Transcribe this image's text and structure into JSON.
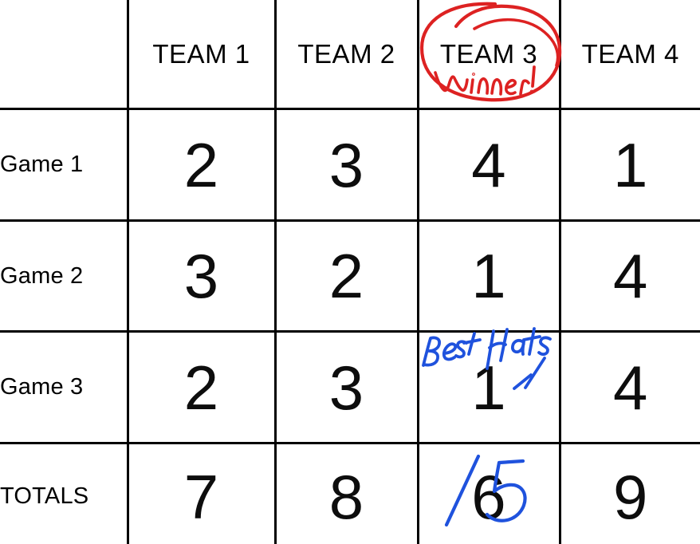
{
  "document": {
    "kind": "scoreboard-table-with-handwritten-annotations",
    "background_color": "#ffffff",
    "grid_line_color": "#000000"
  },
  "table": {
    "corner_cell": "",
    "column_headers": [
      "TEAM 1",
      "TEAM 2",
      "TEAM 3",
      "TEAM 4"
    ],
    "row_labels": [
      "Game 1",
      "Game 2",
      "Game 3",
      "TOTALS"
    ],
    "rows": [
      {
        "label": "Game 1",
        "values": [
          "2",
          "3",
          "4",
          "1"
        ]
      },
      {
        "label": "Game 2",
        "values": [
          "3",
          "2",
          "1",
          "4"
        ]
      },
      {
        "label": "Game 3",
        "values": [
          "2",
          "3",
          "1",
          "4"
        ]
      },
      {
        "label": "TOTALS",
        "values": [
          "7",
          "8",
          "6",
          "9"
        ]
      }
    ]
  },
  "annotations": {
    "red_color": "#dd2222",
    "blue_color": "#1f52dd",
    "items": [
      {
        "id": "winner-note",
        "text": "Winner!",
        "color": "#dd2222",
        "target": "TEAM 3 column header",
        "decoration": "hand-drawn red ellipse circling the TEAM 3 header"
      },
      {
        "id": "best-hats-note",
        "text": "Best Hats",
        "color": "#1f52dd",
        "target": "Game 3 / TEAM 3 cell",
        "decoration": "small blue arrow pointing down-left toward the score"
      },
      {
        "id": "totals-correction",
        "text": "5",
        "color": "#1f52dd",
        "target": "TOTALS / TEAM 3 cell",
        "decoration": "blue diagonal strikethrough over the printed 6, corrected value 5 written beside it",
        "original_value": "6",
        "corrected_value": "5"
      }
    ]
  }
}
